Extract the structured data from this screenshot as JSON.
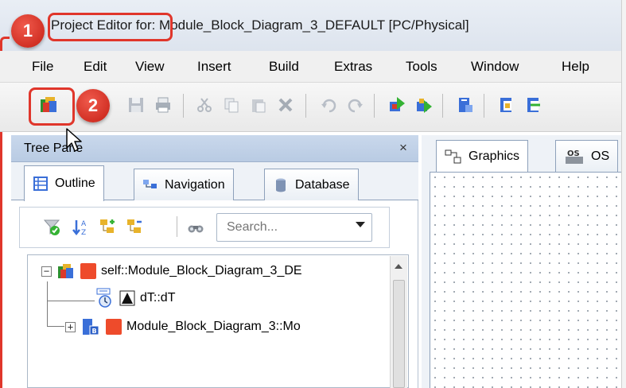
{
  "window": {
    "title_highlighted": "Project Editor",
    "title_rest": " for: Module_Block_Diagram_3_DEFAULT [PC/Physical]"
  },
  "menu": {
    "items": [
      "File",
      "Edit",
      "View",
      "Insert",
      "Build",
      "Extras",
      "Tools",
      "Window",
      "Help"
    ]
  },
  "steps": {
    "step1": "1",
    "step2": "2"
  },
  "tree_pane": {
    "title": "Tree Pane",
    "close": "×",
    "tabs": [
      {
        "label": "Outline",
        "icon": "outline-icon",
        "active": true
      },
      {
        "label": "Navigation",
        "icon": "navigation-icon",
        "active": false
      },
      {
        "label": "Database",
        "icon": "database-icon",
        "active": false
      }
    ],
    "search": {
      "placeholder": "Search..."
    },
    "tree": [
      {
        "label": "self::Module_Block_Diagram_3_DE",
        "expander": "−"
      },
      {
        "label": "dT::dT"
      },
      {
        "label": "Module_Block_Diagram_3::Mo",
        "expander": "+"
      }
    ]
  },
  "graphics": {
    "tabs": [
      {
        "label": "Graphics",
        "icon": "graphics-icon"
      },
      {
        "label": "OS",
        "icon": "os-icon"
      }
    ]
  },
  "colors": {
    "highlight": "#e0362b",
    "pane_header": "#c9d8ec",
    "block_red": "#ee4b2b"
  }
}
